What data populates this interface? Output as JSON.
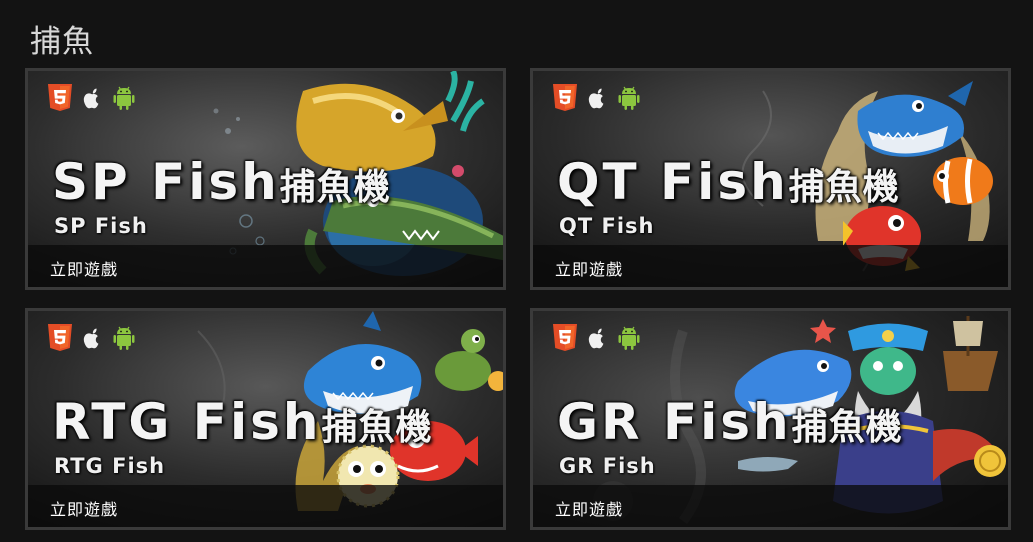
{
  "section": {
    "title": "捕魚"
  },
  "platform_icons": [
    "html5-icon",
    "apple-icon",
    "android-icon"
  ],
  "colors": {
    "background": "#131313",
    "card_border": "#3a3a3a",
    "html5": "#e44d26",
    "android": "#8cc63f"
  },
  "games": [
    {
      "title": "SP Fish",
      "title_cn": "捕魚機",
      "subtitle": "SP Fish",
      "play_label": "立即遊戲"
    },
    {
      "title": "QT Fish",
      "title_cn": "捕魚機",
      "subtitle": "QT Fish",
      "play_label": "立即遊戲"
    },
    {
      "title": "RTG Fish",
      "title_cn": "捕魚機",
      "subtitle": "RTG Fish",
      "play_label": "立即遊戲"
    },
    {
      "title": "GR Fish",
      "title_cn": "捕魚機",
      "subtitle": "GR Fish",
      "play_label": "立即遊戲"
    }
  ]
}
